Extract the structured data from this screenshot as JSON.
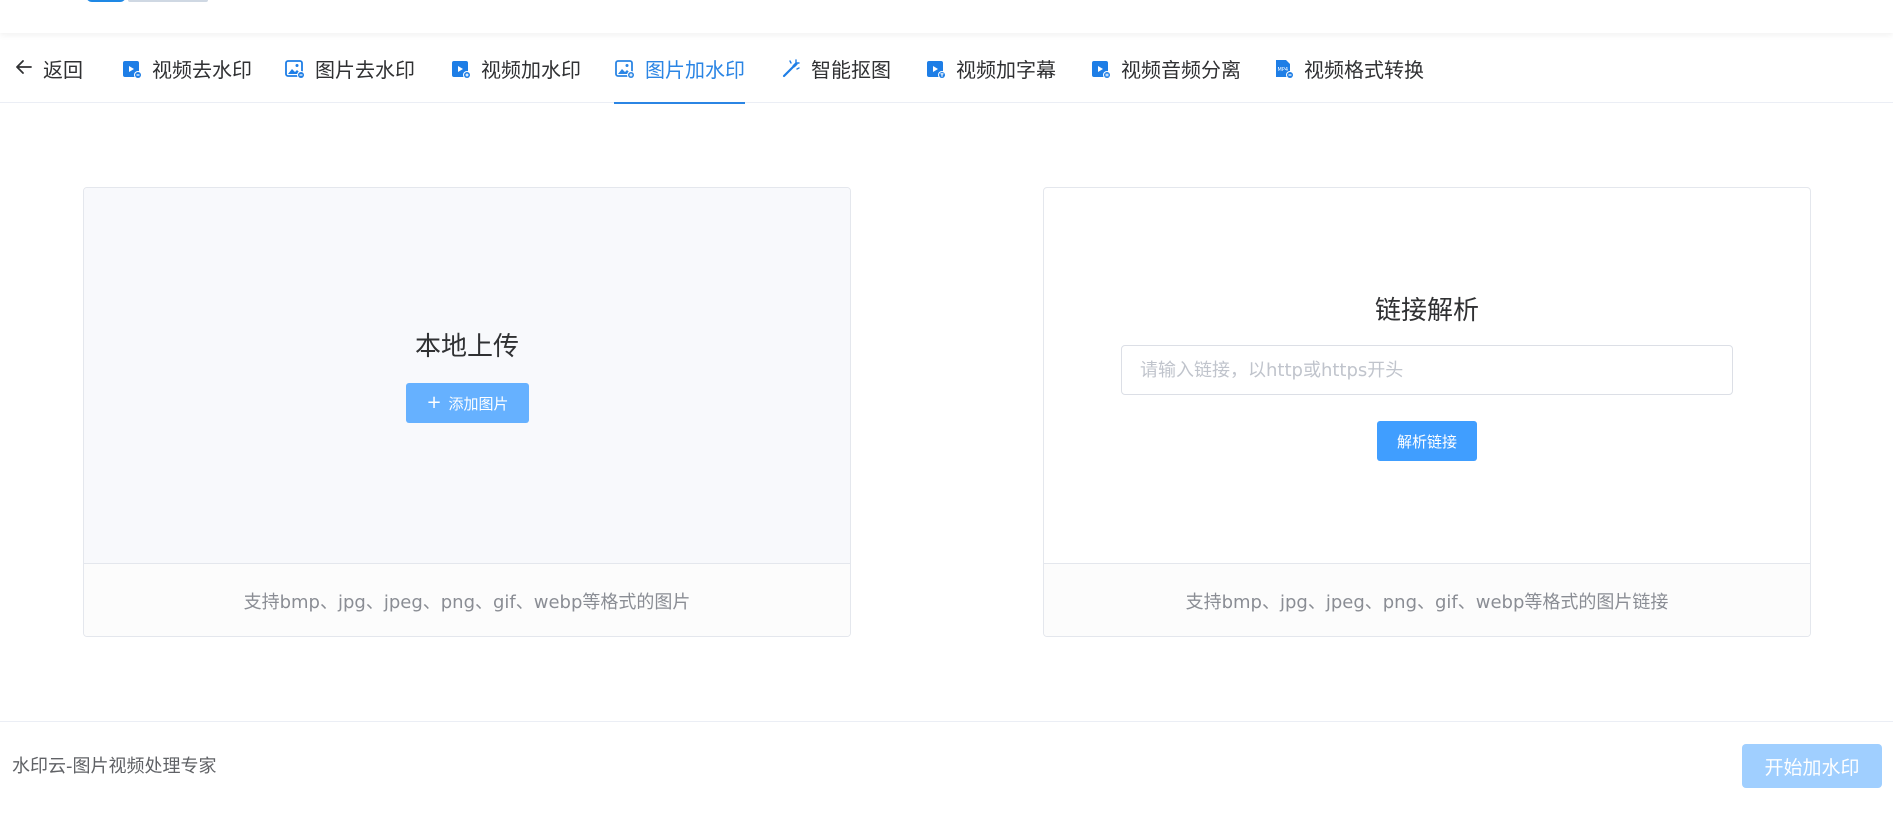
{
  "nav": {
    "back_label": "返回",
    "items": [
      {
        "label": "视频去水印",
        "icon": "video-icon"
      },
      {
        "label": "图片去水印",
        "icon": "image-icon"
      },
      {
        "label": "视频加水印",
        "icon": "video-add-icon"
      },
      {
        "label": "图片加水印",
        "icon": "image-add-icon",
        "active": true
      },
      {
        "label": "智能抠图",
        "icon": "magic-wand-icon"
      },
      {
        "label": "视频加字幕",
        "icon": "video-text-icon"
      },
      {
        "label": "视频音频分离",
        "icon": "video-audio-icon"
      },
      {
        "label": "视频格式转换",
        "icon": "mp4-icon"
      }
    ]
  },
  "upload": {
    "title": "本地上传",
    "button_label": "添加图片",
    "hint": "支持bmp、jpg、jpeg、png、gif、webp等格式的图片"
  },
  "link": {
    "title": "链接解析",
    "input_placeholder": "请输入链接，以http或https开头",
    "input_value": "",
    "button_label": "解析链接",
    "hint": "支持bmp、jpg、jpeg、png、gif、webp等格式的图片链接"
  },
  "footer": {
    "brand": "水印云-图片视频处理专家",
    "start_label": "开始加水印"
  },
  "colors": {
    "accent": "#2b85e4",
    "button_primary": "#409eff",
    "button_light": "#66b1ff",
    "button_disabled": "#a0cfff"
  }
}
